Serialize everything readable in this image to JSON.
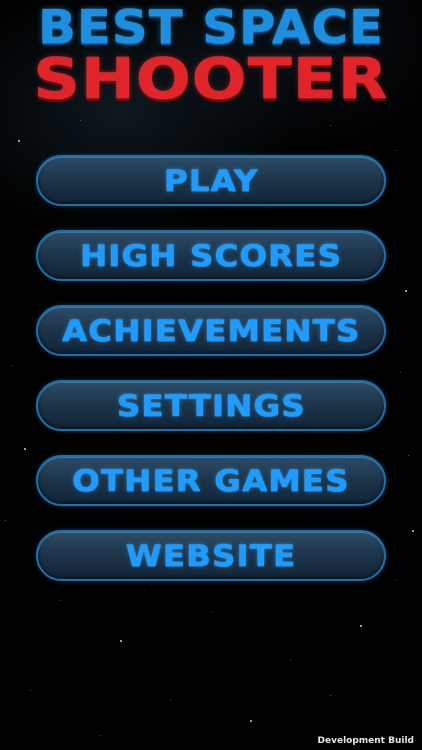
{
  "title": {
    "line1": "BEST SPACE",
    "line2": "SHOOTER"
  },
  "menu": {
    "items": [
      {
        "label": "PLAY"
      },
      {
        "label": "HIGH SCORES"
      },
      {
        "label": "ACHIEVEMENTS"
      },
      {
        "label": "SETTINGS"
      },
      {
        "label": "OTHER GAMES"
      },
      {
        "label": "WEBSITE"
      }
    ]
  },
  "footer": {
    "build_label": "Development Build"
  },
  "colors": {
    "title_blue": "#1e8fe0",
    "title_red": "#e0242a",
    "button_text": "#1e9bff",
    "button_border": "#1f6fa8",
    "background": "#000000"
  }
}
